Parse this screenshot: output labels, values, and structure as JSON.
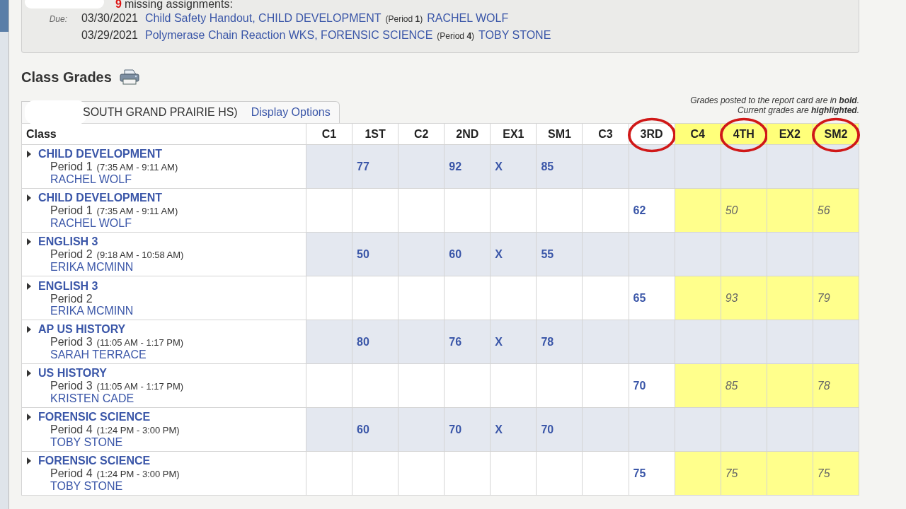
{
  "missing": {
    "count": "9",
    "label": "missing assignments:",
    "due_label": "Due:",
    "items": [
      {
        "date": "03/30/2021",
        "assignment": "Child Safety Handout, CHILD DEVELOPMENT",
        "period": "(Period **1**)",
        "teacher": "RACHEL WOLF"
      },
      {
        "date": "03/29/2021",
        "assignment": "Polymerase Chain Reaction WKS, FORENSIC SCIENCE",
        "period": "(Period **4**)",
        "teacher": "TOBY STONE"
      }
    ]
  },
  "section_title": "Class Grades",
  "school_tab": "SOUTH GRAND PRAIRIE HS)",
  "display_options": "Display Options",
  "legend": [
    "Grades posted to the report card are in **bold**.",
    "Current grades are **highlighted**."
  ],
  "columns": [
    {
      "label": "Class",
      "highlighted": false,
      "circled": false
    },
    {
      "label": "C1",
      "highlighted": false,
      "circled": false
    },
    {
      "label": "1ST",
      "highlighted": false,
      "circled": false
    },
    {
      "label": "C2",
      "highlighted": false,
      "circled": false
    },
    {
      "label": "2ND",
      "highlighted": false,
      "circled": false
    },
    {
      "label": "EX1",
      "highlighted": false,
      "circled": false
    },
    {
      "label": "SM1",
      "highlighted": false,
      "circled": false
    },
    {
      "label": "C3",
      "highlighted": false,
      "circled": false
    },
    {
      "label": "3RD",
      "highlighted": false,
      "circled": true
    },
    {
      "label": "C4",
      "highlighted": true,
      "circled": false
    },
    {
      "label": "4TH",
      "highlighted": true,
      "circled": true
    },
    {
      "label": "EX2",
      "highlighted": true,
      "circled": false
    },
    {
      "label": "SM2",
      "highlighted": true,
      "circled": true
    }
  ],
  "rows": [
    {
      "course": "CHILD DEVELOPMENT",
      "period": "Period 1",
      "times": "(7:35 AM - 9:11 AM)",
      "teacher": "RACHEL WOLF",
      "shaded": true,
      "grades": {
        "q1": "77",
        "q2": "92",
        "ex1": "X",
        "sm1": "85"
      }
    },
    {
      "course": "CHILD DEVELOPMENT",
      "period": "Period 1",
      "times": "(7:35 AM - 9:11 AM)",
      "teacher": "RACHEL WOLF",
      "shaded": false,
      "grades": {
        "q3": "62",
        "q4": "50",
        "sm2": "56"
      }
    },
    {
      "course": "ENGLISH 3",
      "period": "Period 2",
      "times": "(9:18 AM - 10:58 AM)",
      "teacher": "ERIKA MCMINN",
      "shaded": true,
      "grades": {
        "q1": "50",
        "q2": "60",
        "ex1": "X",
        "sm1": "55"
      }
    },
    {
      "course": "ENGLISH 3",
      "period": "Period 2",
      "teacher": "ERIKA MCMINN",
      "shaded": false,
      "grades": {
        "q3": "65",
        "q4": "93",
        "sm2": "79"
      }
    },
    {
      "course": "AP US HISTORY",
      "period": "Period 3",
      "times": "(11:05 AM - 1:17 PM)",
      "teacher": "SARAH TERRACE",
      "shaded": true,
      "grades": {
        "q1": "80",
        "q2": "76",
        "ex1": "X",
        "sm1": "78"
      }
    },
    {
      "course": "US HISTORY",
      "period": "Period 3",
      "times": "(11:05 AM - 1:17 PM)",
      "teacher": "KRISTEN CADE",
      "shaded": false,
      "grades": {
        "q3": "70",
        "q4": "85",
        "sm2": "78"
      }
    },
    {
      "course": "FORENSIC SCIENCE",
      "period": "Period 4",
      "times": "(1:24 PM - 3:00 PM)",
      "teacher": "TOBY STONE",
      "shaded": true,
      "grades": {
        "q1": "60",
        "q2": "70",
        "ex1": "X",
        "sm1": "70"
      }
    },
    {
      "course": "FORENSIC SCIENCE",
      "period": "Period 4",
      "times": "(1:24 PM - 3:00 PM)",
      "teacher": "TOBY STONE",
      "shaded": false,
      "grades": {
        "q3": "75",
        "q4": "75",
        "sm2": "75"
      }
    }
  ]
}
